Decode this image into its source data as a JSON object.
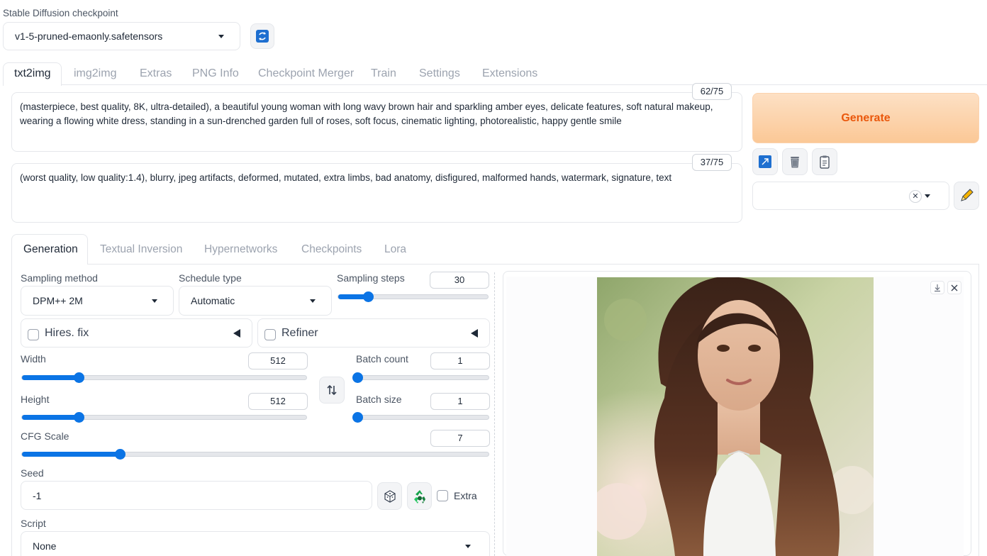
{
  "checkpoint": {
    "label": "Stable Diffusion checkpoint",
    "value": "v1-5-pruned-emaonly.safetensors"
  },
  "tabs": [
    {
      "label": "txt2img",
      "active": true
    },
    {
      "label": "img2img"
    },
    {
      "label": "Extras"
    },
    {
      "label": "PNG Info"
    },
    {
      "label": "Checkpoint Merger"
    },
    {
      "label": "Train"
    },
    {
      "label": "Settings"
    },
    {
      "label": "Extensions"
    }
  ],
  "prompt": {
    "text": "(masterpiece, best quality, 8K, ultra-detailed), a beautiful young woman with long wavy brown hair and sparkling amber eyes, delicate features, soft natural makeup, wearing a flowing white dress, standing in a sun-drenched garden full of roses, soft focus, cinematic lighting, photorealistic, happy gentle smile",
    "counter": "62/75"
  },
  "negative_prompt": {
    "text": "(worst quality, low quality:1.4), blurry, jpeg artifacts, deformed, mutated, extra limbs, bad anatomy, disfigured, malformed hands, watermark, signature, text",
    "counter": "37/75"
  },
  "generate": {
    "label": "Generate"
  },
  "subtabs": [
    {
      "label": "Generation",
      "active": true
    },
    {
      "label": "Textual Inversion"
    },
    {
      "label": "Hypernetworks"
    },
    {
      "label": "Checkpoints"
    },
    {
      "label": "Lora"
    }
  ],
  "sampling_method": {
    "label": "Sampling method",
    "value": "DPM++ 2M"
  },
  "schedule_type": {
    "label": "Schedule type",
    "value": "Automatic"
  },
  "sampling_steps": {
    "label": "Sampling steps",
    "value": "30",
    "fraction": 0.2
  },
  "hires_fix": {
    "label": "Hires. fix"
  },
  "refiner": {
    "label": "Refiner"
  },
  "width": {
    "label": "Width",
    "value": "512",
    "fraction": 0.2
  },
  "height": {
    "label": "Height",
    "value": "512",
    "fraction": 0.2
  },
  "batch_count": {
    "label": "Batch count",
    "value": "1",
    "fraction": 0.0
  },
  "batch_size": {
    "label": "Batch size",
    "value": "1",
    "fraction": 0.0
  },
  "cfg_scale": {
    "label": "CFG Scale",
    "value": "7",
    "fraction": 0.21
  },
  "seed": {
    "label": "Seed",
    "value": "-1",
    "extra_label": "Extra"
  },
  "script": {
    "label": "Script",
    "value": "None"
  },
  "icons": {
    "refresh": "refresh-icon",
    "paste": "arrow-icon",
    "trash": "trash-icon",
    "clipboard": "clipboard-icon",
    "pencil": "pencil-icon",
    "swap": "swap-arrows-icon",
    "dice": "dice-icon",
    "recycle": "recycle-icon",
    "download": "download-icon",
    "close": "close-icon"
  },
  "colors": {
    "accent": "#0b74e5",
    "generate_bg": "#fdd8b6",
    "generate_text": "#ea580c"
  }
}
